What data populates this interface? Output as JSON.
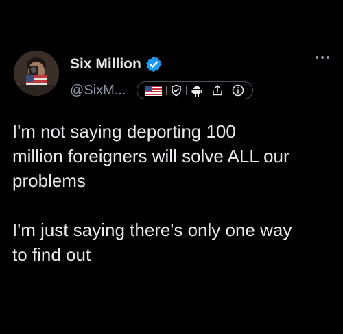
{
  "author": {
    "display_name": "Six Million",
    "handle": "@SixM..."
  },
  "icons": {
    "verified": "verified-badge-icon",
    "flag": "us-flag-icon",
    "shield": "shield-check-icon",
    "android": "android-icon",
    "share": "share-icon",
    "info": "info-icon",
    "more": "more-dots-icon"
  },
  "colors": {
    "background": "#000000",
    "text": "#e7e9ea",
    "secondary": "#8b98a5",
    "verified": "#1d9bf0"
  },
  "tweet": {
    "paragraph_1": "I'm not saying deporting 100\nmillion foreigners will solve ALL our\nproblems",
    "paragraph_2": "I'm just saying there's only one way\nto find out"
  }
}
